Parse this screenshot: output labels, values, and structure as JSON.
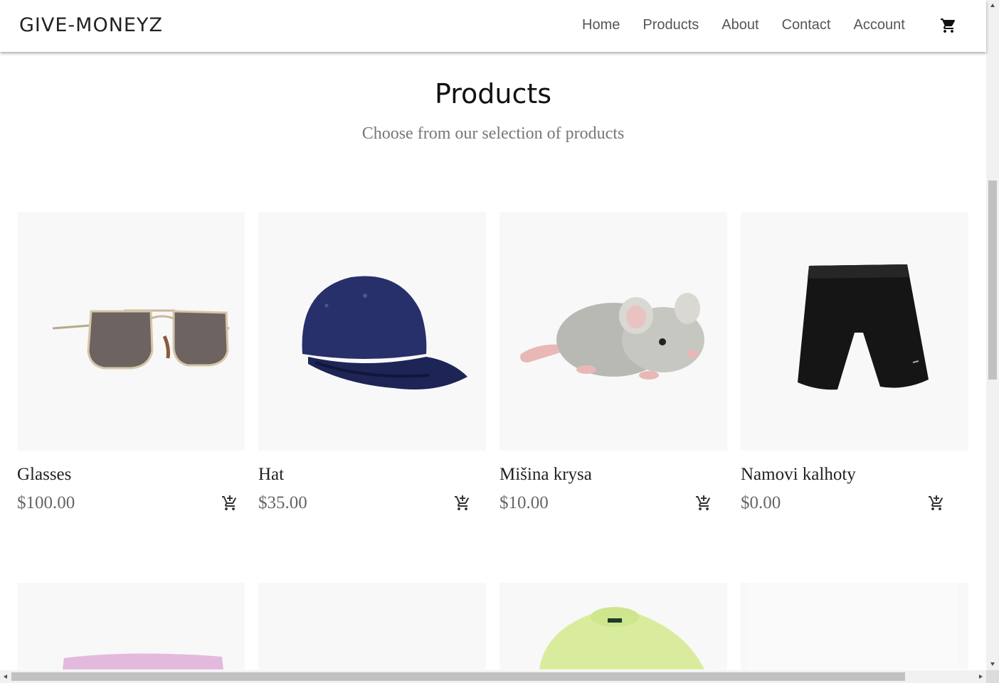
{
  "header": {
    "logo": "GIVE-MONEYZ",
    "nav": [
      "Home",
      "Products",
      "About",
      "Contact",
      "Account"
    ],
    "cart_icon": "shopping-cart-icon"
  },
  "section": {
    "title": "Products",
    "subtitle": "Choose from our selection of products"
  },
  "products": [
    {
      "name": "Glasses",
      "price": "$100.00",
      "image": "sunglasses"
    },
    {
      "name": "Hat",
      "price": "$35.00",
      "image": "baseball-cap"
    },
    {
      "name": "Mišina krysa",
      "price": "$10.00",
      "image": "plush-rat"
    },
    {
      "name": "Namovi kalhoty",
      "price": "$0.00",
      "image": "black-shorts"
    }
  ],
  "products_row2": [
    {
      "image": "pink-knit-item"
    },
    {
      "image": "blank"
    },
    {
      "image": "green-sweater"
    },
    {
      "image": "blank"
    }
  ],
  "icons": {
    "add_to_cart": "add-to-cart-icon"
  },
  "colors": {
    "background": "#ffffff",
    "card_bg": "#f8f8f8",
    "nav_text": "#555555",
    "price_text": "#666666"
  }
}
